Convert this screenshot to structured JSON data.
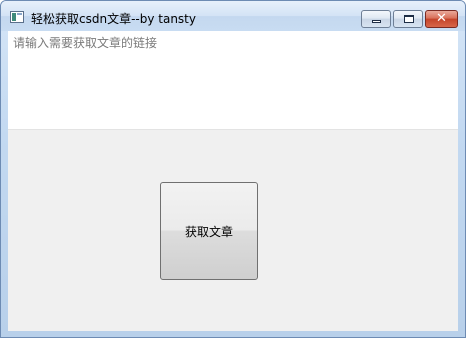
{
  "window": {
    "title": "轻松获取csdn文章--by tansty"
  },
  "title_buttons": {
    "close_glyph": "✕"
  },
  "link_input": {
    "value": "",
    "placeholder": "请输入需要获取文章的链接"
  },
  "fetch_button": {
    "label": "获取文章"
  }
}
